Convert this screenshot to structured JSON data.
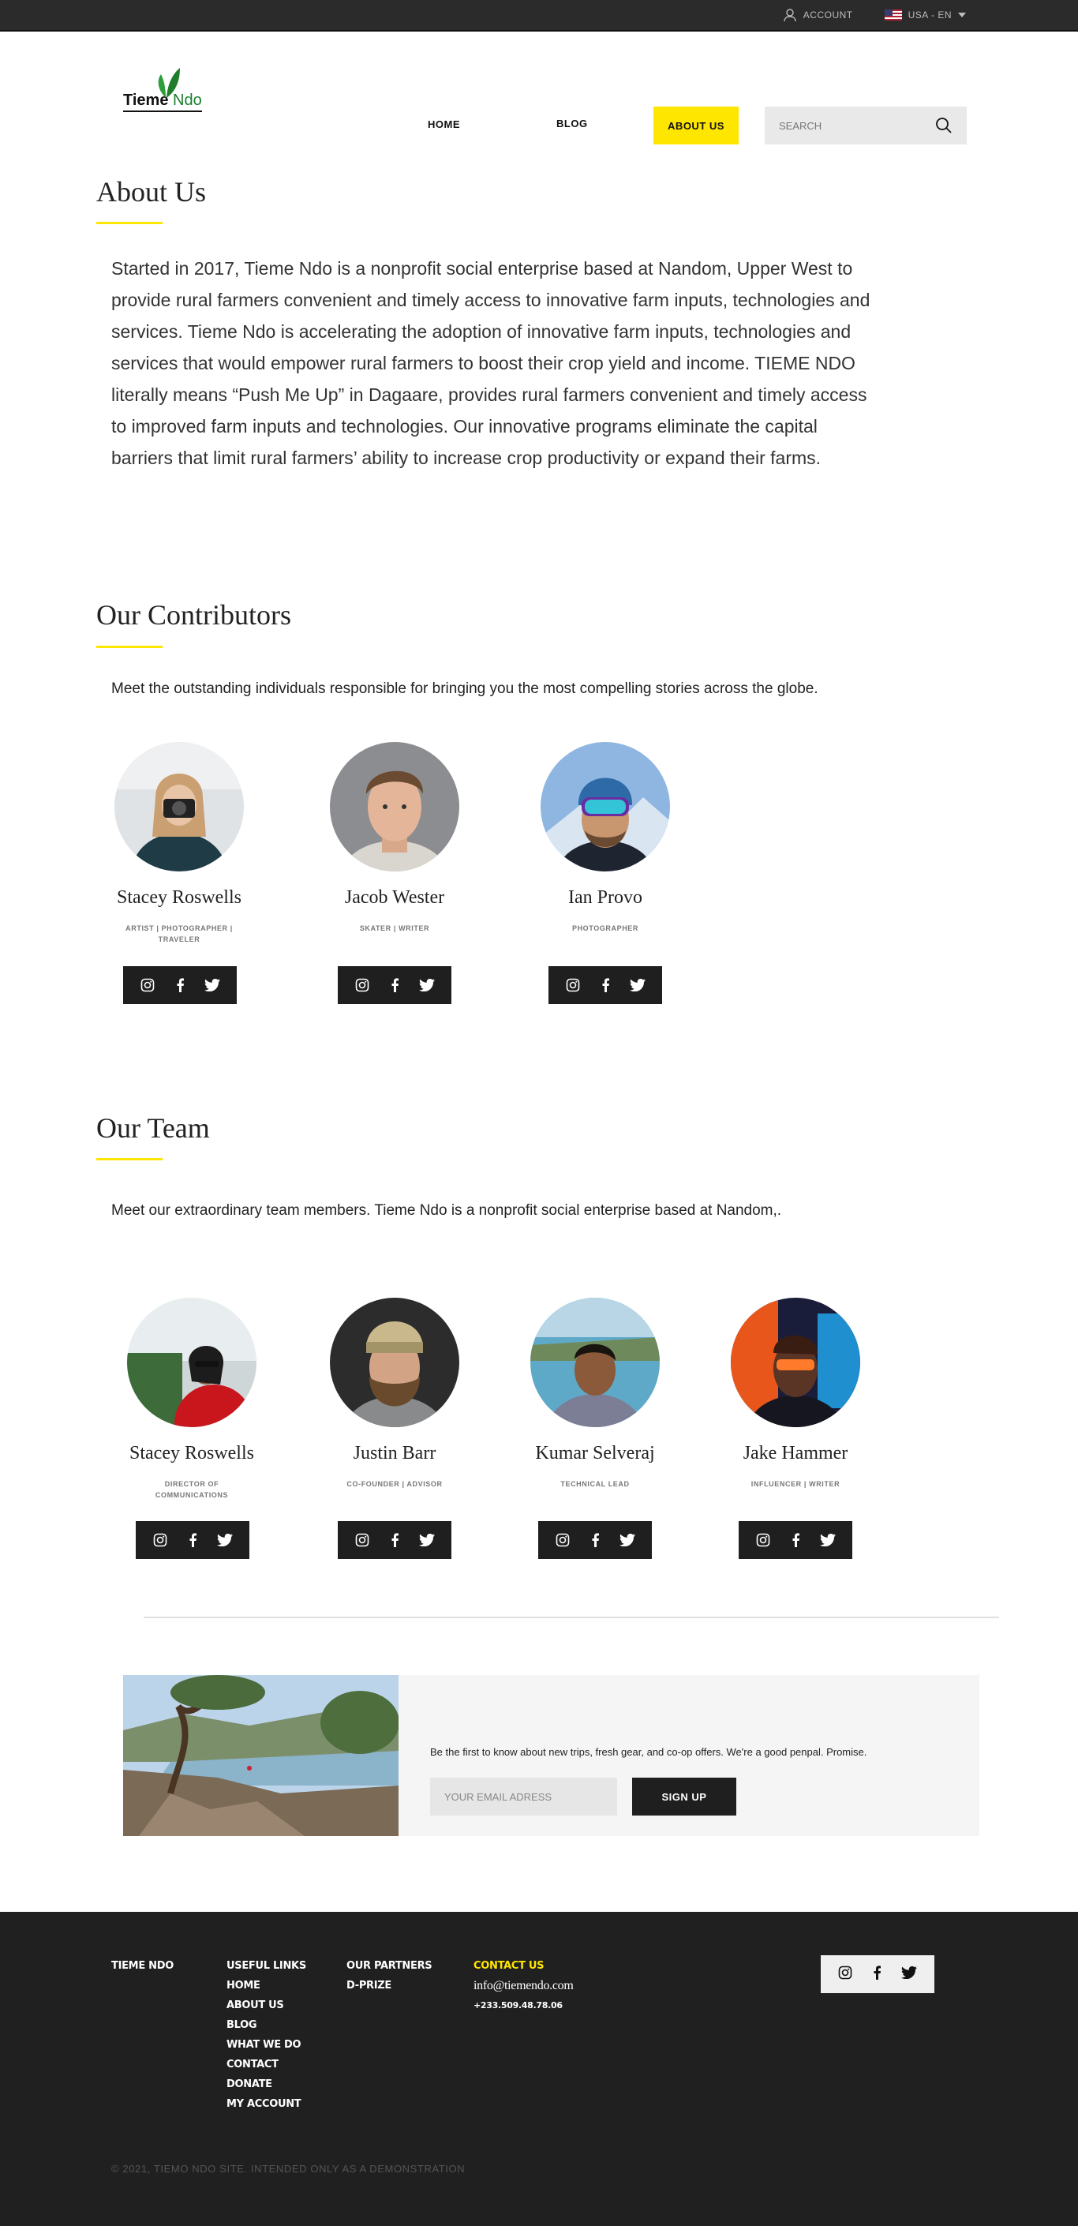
{
  "topbar": {
    "account_label": "ACCOUNT",
    "locale_label": "USA - EN"
  },
  "header": {
    "logo": {
      "brand": "Tieme",
      "brand_suffix": "Ndo"
    },
    "nav": {
      "home": "HOME",
      "blog": "BLOG",
      "about": "ABOUT US"
    },
    "search_placeholder": "SEARCH"
  },
  "about": {
    "title": "About Us",
    "body": "Started in 2017, Tieme Ndo is a nonprofit social enterprise based at Nandom, Upper West to provide rural farmers convenient and timely access to innovative farm inputs, technologies and services. Tieme Ndo is accelerating the adoption of innovative farm inputs, technologies and services that would empower rural farmers to boost their crop yield and income. TIEME NDO literally means “Push Me Up” in Dagaare, provides rural farmers convenient and timely access to improved farm inputs and technologies. Our innovative programs eliminate the capital barriers that limit rural farmers’ ability to increase crop productivity or expand their farms."
  },
  "contributors": {
    "title": "Our Contributors",
    "intro": "Meet the outstanding individuals responsible for bringing you the most compelling stories across the globe.",
    "people": [
      {
        "name": "Stacey Roswells",
        "role": "ARTIST | PHOTOGRAPHER | TRAVELER"
      },
      {
        "name": "Jacob Wester",
        "role": "SKATER | WRITER"
      },
      {
        "name": "Ian Provo",
        "role": "PHOTOGRAPHER"
      }
    ]
  },
  "team": {
    "title": "Our Team",
    "intro": "Meet our extraordinary team members. Tieme Ndo is a nonprofit social enterprise based at Nandom,.",
    "people": [
      {
        "name": "Stacey Roswells",
        "role": "DIRECTOR OF COMMUNICATIONS"
      },
      {
        "name": "Justin Barr",
        "role": "CO-FOUNDER | ADVISOR"
      },
      {
        "name": "Kumar Selveraj",
        "role": "TECHNICAL LEAD"
      },
      {
        "name": "Jake Hammer",
        "role": "INFLUENCER | WRITER"
      }
    ]
  },
  "newsletter": {
    "text": "Be the first to know about new trips, fresh gear, and co-op offers. We're a good penpal. Promise.",
    "email_placeholder": "YOUR EMAIL ADRESS",
    "button": "SIGN UP"
  },
  "footer": {
    "brand": "TIEME NDO",
    "useful_links_title": "USEFUL LINKS",
    "useful_links": [
      "HOME",
      "ABOUT US",
      "BLOG",
      "WHAT WE DO",
      "CONTACT",
      "DONATE",
      "MY ACCOUNT"
    ],
    "partners_title": "OUR PARTNERS",
    "partners": [
      "D-PRIZE"
    ],
    "contact_title": "CONTACT US",
    "email": "info@tiemendo.com",
    "phone": "+233.509.48.78.06",
    "copyright": "© 2021, TIEMO NDO SITE. INTENDED ONLY AS A DEMONSTRATION"
  },
  "colors": {
    "accent": "#ffe600",
    "dark": "#202020",
    "topbar": "#2b2b2b"
  },
  "icons": [
    "user-icon",
    "us-flag-icon",
    "search-icon",
    "instagram-icon",
    "facebook-icon",
    "twitter-icon",
    "leaf-logo-icon"
  ]
}
